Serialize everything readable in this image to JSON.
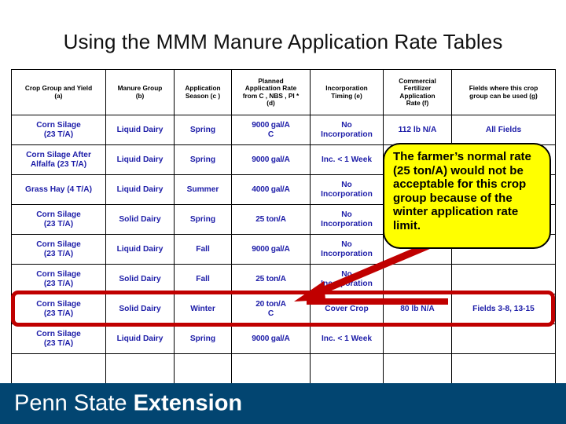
{
  "slide": {
    "title": "Using the MMM Manure Application Rate Tables"
  },
  "table": {
    "headers": [
      "Crop Group and Yield (a)",
      "Manure Group (b)",
      "Application Season (c )",
      "Planned Application Rate from C , NBS , PI * (d)",
      "Incorporation Timing (e)",
      "Commercial Fertilizer Application Rate (f)",
      "Fields where this crop group can be used (g)"
    ],
    "headers_lines": {
      "h1": [
        "Crop Group and Yield",
        "(a)"
      ],
      "h2": [
        "Manure Group",
        "(b)"
      ],
      "h3": [
        "Application",
        "Season (c )"
      ],
      "h4": [
        "Planned",
        "Application Rate",
        "from C , NBS , PI *",
        "(d)"
      ],
      "h5": [
        "Incorporation",
        "Timing (e)"
      ],
      "h6": [
        "Commercial",
        "Fertilizer",
        "Application",
        "Rate (f)"
      ],
      "h7": [
        "Fields where this crop",
        "group can be used (g)"
      ]
    },
    "rows": [
      {
        "crop_group": "Corn Silage (23 T/A)",
        "crop_group_l1": "Corn Silage",
        "crop_group_l2": "(23 T/A)",
        "manure_group": "Liquid Dairy",
        "season": "Spring",
        "rate": "9000 gal/A C",
        "rate_l1": "9000 gal/A",
        "rate_l2": "C",
        "incorporation": "No Incorporation",
        "incorporation_l1": "No",
        "incorporation_l2": "Incorporation",
        "fertilizer": "112 lb N/A",
        "fields": "All Fields",
        "highlighted": false
      },
      {
        "crop_group": "Corn Silage After Alfalfa (23 T/A)",
        "crop_group_l1": "Corn Silage After",
        "crop_group_l2": "Alfalfa (23 T/A)",
        "manure_group": "Liquid Dairy",
        "season": "Spring",
        "rate": "9000 gal/A",
        "rate_l1": "9000 gal/A",
        "rate_l2": "",
        "incorporation": "Inc. < 1 Week",
        "incorporation_l1": "Inc. < 1 Week",
        "incorporation_l2": "",
        "fertilizer": "",
        "fields": "",
        "highlighted": false
      },
      {
        "crop_group": "Grass Hay (4 T/A)",
        "crop_group_l1": "Grass Hay (4 T/A)",
        "crop_group_l2": "",
        "manure_group": "Liquid Dairy",
        "season": "Summer",
        "rate": "4000 gal/A",
        "rate_l1": "4000 gal/A",
        "rate_l2": "",
        "incorporation": "No Incorporation",
        "incorporation_l1": "No",
        "incorporation_l2": "Incorporation",
        "fertilizer": "",
        "fields": "",
        "highlighted": false
      },
      {
        "crop_group": "Corn Silage (23 T/A)",
        "crop_group_l1": "Corn Silage",
        "crop_group_l2": "(23 T/A)",
        "manure_group": "Solid Dairy",
        "season": "Spring",
        "rate": "25 ton/A",
        "rate_l1": "25 ton/A",
        "rate_l2": "",
        "incorporation": "No Incorporation",
        "incorporation_l1": "No",
        "incorporation_l2": "Incorporation",
        "fertilizer": "",
        "fields": "",
        "highlighted": false
      },
      {
        "crop_group": "Corn Silage (23 T/A)",
        "crop_group_l1": "Corn Silage",
        "crop_group_l2": "(23 T/A)",
        "manure_group": "Liquid Dairy",
        "season": "Fall",
        "rate": "9000 gal/A",
        "rate_l1": "9000 gal/A",
        "rate_l2": "",
        "incorporation": "No Incorporation",
        "incorporation_l1": "No",
        "incorporation_l2": "Incorporation",
        "fertilizer": "",
        "fields": "",
        "highlighted": false
      },
      {
        "crop_group": "Corn Silage (23 T/A)",
        "crop_group_l1": "Corn Silage",
        "crop_group_l2": "(23 T/A)",
        "manure_group": "Solid Dairy",
        "season": "Fall",
        "rate": "25 ton/A",
        "rate_l1": "25 ton/A",
        "rate_l2": "",
        "incorporation": "No Incorporation",
        "incorporation_l1": "No",
        "incorporation_l2": "Incorporation",
        "fertilizer": "",
        "fields": "",
        "highlighted": false
      },
      {
        "crop_group": "Corn Silage (23 T/A)",
        "crop_group_l1": "Corn Silage",
        "crop_group_l2": "(23 T/A)",
        "manure_group": "Solid Dairy",
        "season": "Winter",
        "rate": "20 ton/A C",
        "rate_l1": "20 ton/A",
        "rate_l2": "C",
        "incorporation": "Cover Crop",
        "incorporation_l1": "Cover Crop",
        "incorporation_l2": "",
        "fertilizer": "80 lb N/A",
        "fields": "Fields 3-8, 13-15",
        "highlighted": true
      },
      {
        "crop_group": "Corn Silage (23 T/A)",
        "crop_group_l1": "Corn Silage",
        "crop_group_l2": "(23 T/A)",
        "manure_group": "Liquid Dairy",
        "season": "Spring",
        "rate": "9000 gal/A",
        "rate_l1": "9000 gal/A",
        "rate_l2": "",
        "incorporation": "Inc. < 1 Week",
        "incorporation_l1": "Inc. < 1 Week",
        "incorporation_l2": "",
        "fertilizer": "",
        "fields": "",
        "highlighted": false
      },
      {
        "crop_group": "",
        "crop_group_l1": "",
        "crop_group_l2": "",
        "manure_group": "",
        "season": "",
        "rate": "",
        "rate_l1": "",
        "rate_l2": "",
        "incorporation": "",
        "incorporation_l1": "",
        "incorporation_l2": "",
        "fertilizer": "",
        "fields": "",
        "highlighted": false
      }
    ]
  },
  "callout": {
    "text": "The farmer’s normal rate (25 ton/A) would not be acceptable for this crop group because of the winter application rate limit.",
    "background_color": "#ffff00",
    "border_color": "#000000",
    "arrow_color": "#c00000"
  },
  "highlight": {
    "color": "#c00000"
  },
  "footer": {
    "brand_light": "Penn State",
    "brand_bold": "Extension",
    "background_color": "#024571"
  }
}
